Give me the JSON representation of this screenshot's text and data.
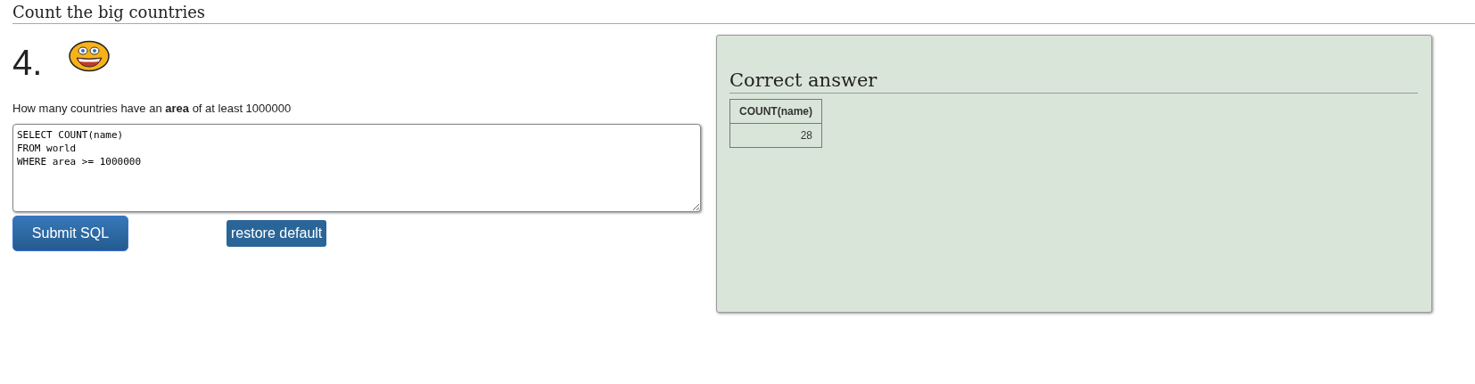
{
  "page_title": "Count the big countries",
  "question": {
    "number": "4.",
    "text": "How many countries have an **area** of at least 1000000"
  },
  "sql_editor": {
    "value": "SELECT COUNT(name)\nFROM world\nWHERE area >= 1000000"
  },
  "buttons": [
    {
      "label": "Submit SQL",
      "kind": "submit"
    },
    {
      "label": "restore default",
      "kind": "restore"
    }
  ],
  "answer_panel": {
    "title": "Correct answer",
    "table": {
      "columns": [
        "COUNT(name)"
      ],
      "rows": [
        [
          "28"
        ]
      ]
    }
  }
}
